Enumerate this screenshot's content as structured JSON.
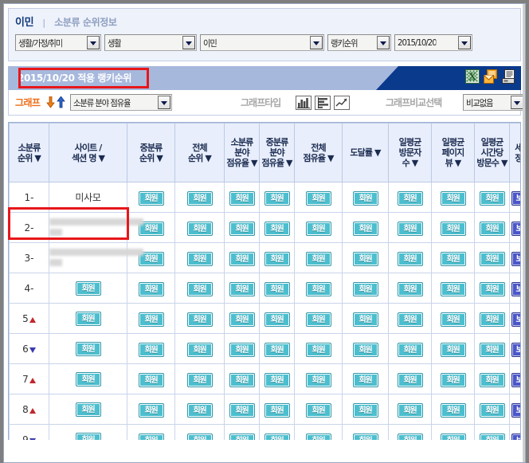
{
  "breadcrumb": {
    "current": "이민",
    "separator": "|",
    "section": "소분류 순위정보"
  },
  "filters": [
    {
      "name": "category-large",
      "value": "생활/가정/취미"
    },
    {
      "name": "category-mid",
      "value": "생활"
    },
    {
      "name": "category-small",
      "value": "이민"
    },
    {
      "name": "rank-type",
      "value": "랭키순위"
    },
    {
      "name": "date",
      "value": "2015/10/20"
    }
  ],
  "panel": {
    "title": "2015/10/20 적용 랭키순위",
    "icons": [
      {
        "name": "excel-export-icon",
        "label": "Excel"
      },
      {
        "name": "email-send-icon",
        "label": "Email"
      },
      {
        "name": "print-icon",
        "label": "Print"
      }
    ]
  },
  "graph_toolbar": {
    "label": "그래프",
    "sort_down_icon": "arrow-down-icon",
    "sort_up_icon": "arrow-up-icon",
    "metric_value": "소분류 분야 점유율",
    "graphtype_label": "그래프타입",
    "graphtype_icons": [
      {
        "name": "bar-chart-vertical-icon"
      },
      {
        "name": "bar-chart-horizontal-icon"
      },
      {
        "name": "line-chart-icon"
      }
    ],
    "compare_label": "그래프비교선택",
    "compare_value": "비교없음"
  },
  "table": {
    "columns": [
      {
        "key": "rank_small",
        "label": "소분류\n순위",
        "sortable": true,
        "width": 50
      },
      {
        "key": "site_name",
        "label": "사이트 /\n섹션 명",
        "sortable": true,
        "width": 98
      },
      {
        "key": "rank_mid",
        "label": "중분류\n순위",
        "sortable": true,
        "width": 60
      },
      {
        "key": "rank_total",
        "label": "전체\n순위",
        "sortable": true,
        "width": 62
      },
      {
        "key": "share_small",
        "label": "소분류\n분야\n점유율",
        "sortable": true,
        "width": 44
      },
      {
        "key": "share_mid",
        "label": "중분류\n분야\n점유율",
        "sortable": true,
        "width": 44
      },
      {
        "key": "share_total",
        "label": "전체\n점유율",
        "sortable": true,
        "width": 60
      },
      {
        "key": "reach",
        "label": "도달률",
        "sortable": true,
        "width": 58
      },
      {
        "key": "visitors",
        "label": "일평균\n방문자\n수",
        "sortable": true,
        "width": 54
      },
      {
        "key": "pageviews",
        "label": "일평균\n페이지\n뷰",
        "sortable": true,
        "width": 54
      },
      {
        "key": "visits_hour",
        "label": "일평균\n시간당\n방문수",
        "sortable": true,
        "width": 44
      },
      {
        "key": "detail",
        "label": "세부\n정보",
        "sortable": false,
        "width": 32
      }
    ],
    "member_badge_label": "회원",
    "view_button_label": "보기",
    "rows": [
      {
        "rank": "1",
        "trend": "none",
        "name": "미사모",
        "name_blurred": false,
        "site_cell": "text",
        "highlighted": true
      },
      {
        "rank": "2",
        "trend": "none",
        "name": "",
        "name_blurred": true,
        "site_cell": "blur",
        "highlighted": false
      },
      {
        "rank": "3",
        "trend": "none",
        "name": "",
        "name_blurred": true,
        "site_cell": "blur",
        "highlighted": false
      },
      {
        "rank": "4",
        "trend": "none",
        "name": "",
        "name_blurred": false,
        "site_cell": "badge",
        "highlighted": false
      },
      {
        "rank": "5",
        "trend": "up",
        "name": "",
        "name_blurred": false,
        "site_cell": "badge",
        "highlighted": false
      },
      {
        "rank": "6",
        "trend": "down",
        "name": "",
        "name_blurred": false,
        "site_cell": "badge",
        "highlighted": false
      },
      {
        "rank": "7",
        "trend": "up",
        "name": "",
        "name_blurred": false,
        "site_cell": "badge",
        "highlighted": false
      },
      {
        "rank": "8",
        "trend": "up",
        "name": "",
        "name_blurred": false,
        "site_cell": "badge",
        "highlighted": false
      },
      {
        "rank": "9",
        "trend": "down",
        "name": "",
        "name_blurred": false,
        "site_cell": "badge",
        "highlighted": false
      }
    ]
  },
  "colors": {
    "title_bar": "#0a3a8c",
    "title_bar_light": "#a7b8dd",
    "highlight_red": "#e8161a",
    "graph_orange": "#ee6b15",
    "member_badge": "#4bbfcf",
    "view_button": "#4a56c8",
    "trend_up": "#c0272d",
    "trend_down": "#3a3ab0",
    "header_bg": "#e8eefb"
  }
}
